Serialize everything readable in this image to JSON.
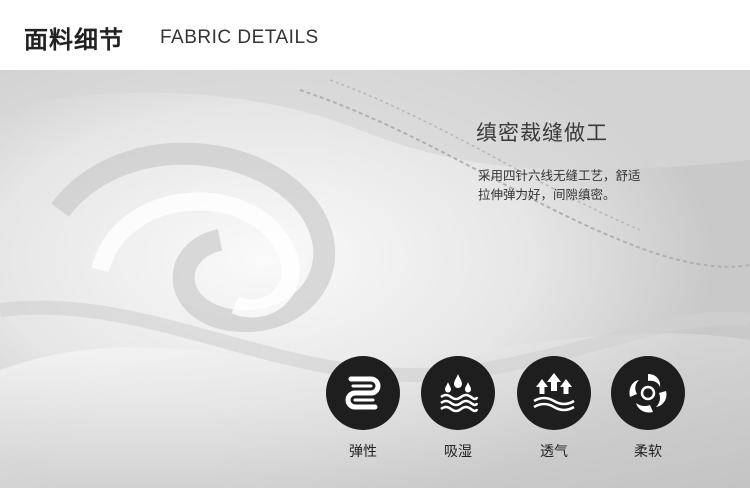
{
  "header": {
    "title_cn": "面料细节",
    "title_en": "FABRIC DETAILS"
  },
  "detail": {
    "title": "缜密裁缝做工",
    "desc_line1": "采用四针六线无缝工艺，舒适",
    "desc_line2": "拉伸弹力好，间隙缜密。"
  },
  "features": [
    {
      "icon": "elastic-wave-icon",
      "label": "弹性"
    },
    {
      "icon": "moisture-drops-icon",
      "label": "吸湿"
    },
    {
      "icon": "breathable-arrows-icon",
      "label": "透气"
    },
    {
      "icon": "soft-swirl-icon",
      "label": "柔软"
    }
  ],
  "colors": {
    "icon_bg": "#1e1e1e",
    "text": "#222222",
    "fabric": "#e8e8e8"
  }
}
